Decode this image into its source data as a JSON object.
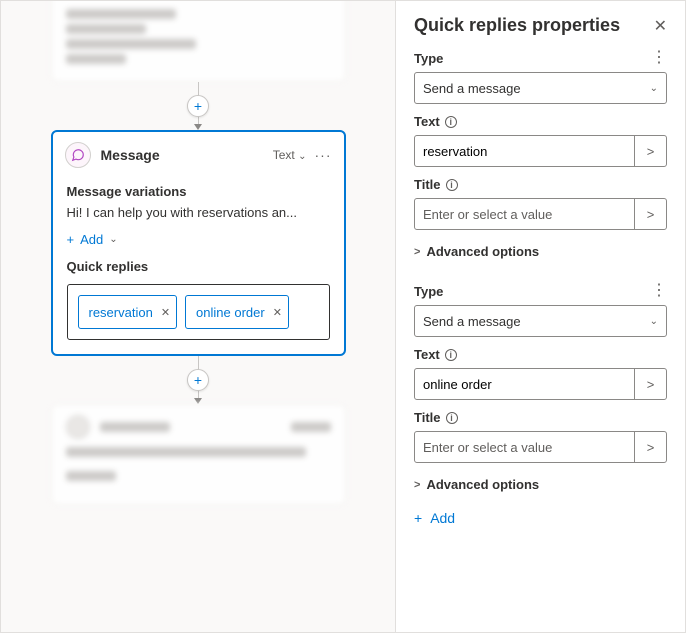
{
  "canvas": {
    "card": {
      "title": "Message",
      "output_type": "Text",
      "variations_label": "Message variations",
      "variation_text": "Hi! I can help you with reservations an...",
      "add_label": "Add",
      "quick_replies_label": "Quick replies",
      "chips": [
        "reservation",
        "online order"
      ]
    }
  },
  "panel": {
    "title": "Quick replies properties",
    "groups": [
      {
        "type_label": "Type",
        "type_value": "Send a message",
        "text_label": "Text",
        "text_value": "reservation",
        "title_label": "Title",
        "title_placeholder": "Enter or select a value",
        "title_value": "",
        "advanced_label": "Advanced options"
      },
      {
        "type_label": "Type",
        "type_value": "Send a message",
        "text_label": "Text",
        "text_value": "online order",
        "title_label": "Title",
        "title_placeholder": "Enter or select a value",
        "title_value": "",
        "advanced_label": "Advanced options"
      }
    ],
    "add_label": "Add"
  }
}
